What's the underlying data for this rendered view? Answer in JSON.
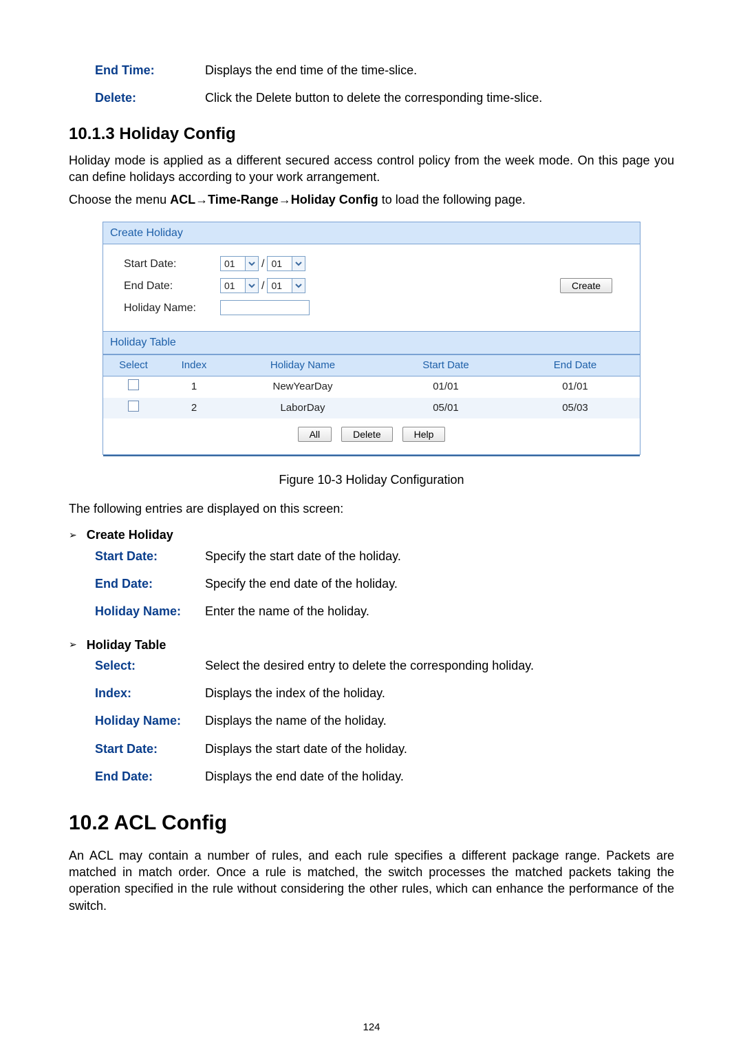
{
  "top_defs": [
    {
      "term": "End Time:",
      "desc": "Displays the end time of the time-slice."
    },
    {
      "term": "Delete:",
      "desc": "Click the Delete button to delete the corresponding time-slice."
    }
  ],
  "section_10_1_3": {
    "heading": "10.1.3  Holiday Config",
    "para": "Holiday mode is applied as a different secured access control policy from the week mode. On this page you can define holidays according to your work arrangement.",
    "menu_prefix": "Choose the menu ",
    "menu_path": "ACL→Time-Range→Holiday Config",
    "menu_suffix": " to load the following page."
  },
  "panel": {
    "create_title": "Create Holiday",
    "labels": {
      "start": "Start Date:",
      "end": "End Date:",
      "name": "Holiday Name:"
    },
    "start_month": "01",
    "start_day": "01",
    "end_month": "01",
    "end_day": "01",
    "slash": "/",
    "create_btn": "Create",
    "table_title": "Holiday Table",
    "cols": {
      "select": "Select",
      "index": "Index",
      "hname": "Holiday Name",
      "sdate": "Start Date",
      "edate": "End Date"
    },
    "rows": [
      {
        "index": "1",
        "name": "NewYearDay",
        "sdate": "01/01",
        "edate": "01/01"
      },
      {
        "index": "2",
        "name": "LaborDay",
        "sdate": "05/01",
        "edate": "05/03"
      }
    ],
    "buttons": {
      "all": "All",
      "delete": "Delete",
      "help": "Help"
    }
  },
  "fig_caption": "Figure 10-3 Holiday Configuration",
  "entries_intro": "The following entries are displayed on this screen:",
  "groups": [
    {
      "title": "Create Holiday",
      "defs": [
        {
          "term": "Start Date:",
          "desc": "Specify the start date of the holiday."
        },
        {
          "term": "End Date:",
          "desc": "Specify the end date of the holiday."
        },
        {
          "term": "Holiday Name:",
          "desc": "Enter the name of the holiday."
        }
      ]
    },
    {
      "title": "Holiday Table",
      "defs": [
        {
          "term": "Select:",
          "desc": "Select the desired entry to delete the corresponding holiday."
        },
        {
          "term": "Index:",
          "desc": "Displays the index of the holiday."
        },
        {
          "term": "Holiday Name:",
          "desc": "Displays the name of the holiday."
        },
        {
          "term": "Start Date:",
          "desc": "Displays the start date of the holiday."
        },
        {
          "term": "End Date:",
          "desc": "Displays the end date of the holiday."
        }
      ]
    }
  ],
  "section_10_2": {
    "heading": "10.2 ACL Config",
    "para": "An ACL may contain a number of rules, and each rule specifies a different package range. Packets are matched in match order. Once a rule is matched, the switch processes the matched packets taking the operation specified in the rule without considering the other rules, which can enhance the performance of the switch."
  },
  "page_number": "124"
}
